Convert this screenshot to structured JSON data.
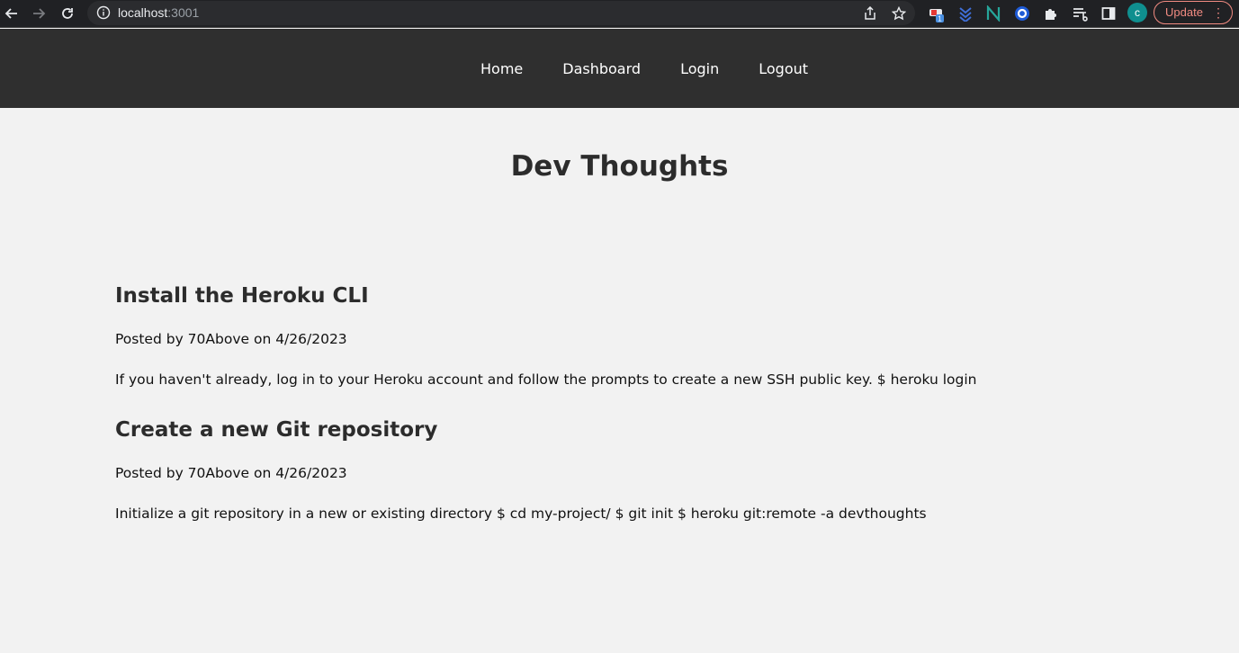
{
  "browser": {
    "url_host": "localhost",
    "url_port": ":3001",
    "avatar_letter": "c",
    "update_label": "Update",
    "badge_count": "1"
  },
  "nav": {
    "items": [
      {
        "label": "Home"
      },
      {
        "label": "Dashboard"
      },
      {
        "label": "Login"
      },
      {
        "label": "Logout"
      }
    ]
  },
  "page": {
    "title": "Dev Thoughts"
  },
  "posts": [
    {
      "title": "Install the Heroku CLI",
      "meta": "Posted by 70Above on 4/26/2023",
      "body": "If you haven't already, log in to your Heroku account and follow the prompts to create a new SSH public key. $ heroku login"
    },
    {
      "title": "Create a new Git repository",
      "meta": "Posted by 70Above on 4/26/2023",
      "body": "Initialize a git repository in a new or existing directory $ cd my-project/ $ git init $ heroku git:remote -a devthoughts"
    }
  ]
}
